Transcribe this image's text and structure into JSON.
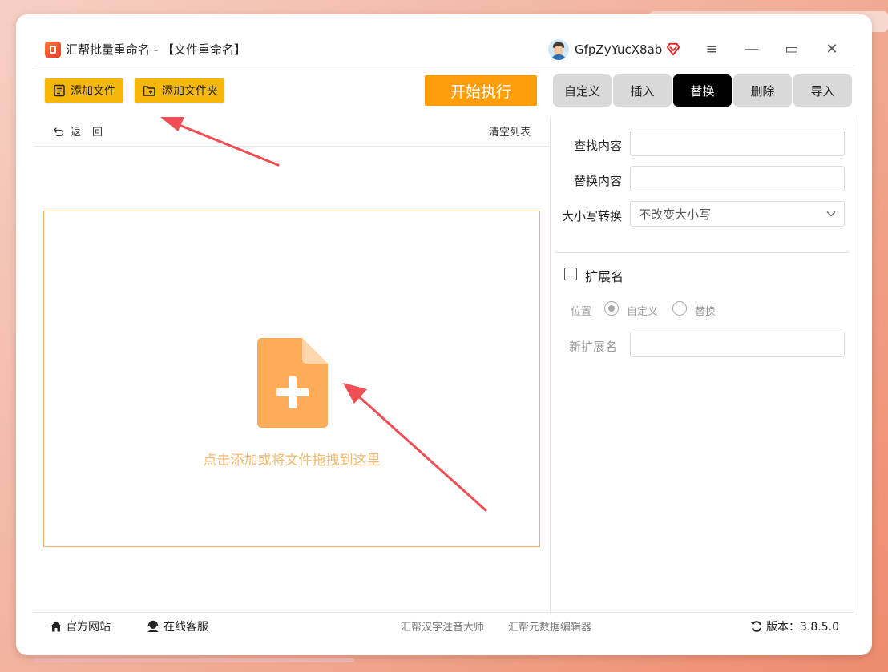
{
  "app": {
    "title": "汇帮批量重命名 - 【文件重命名】",
    "username": "GfpZyYucX8ab"
  },
  "window_controls": {
    "menu": "≡",
    "minimize": "—",
    "maximize": "▭",
    "close": "✕"
  },
  "toolbar": {
    "add_file": "添加文件",
    "add_folder": "添加文件夹",
    "start": "开始执行"
  },
  "tabs": [
    {
      "label": "自定义",
      "active": false
    },
    {
      "label": "插入",
      "active": false
    },
    {
      "label": "替换",
      "active": true
    },
    {
      "label": "删除",
      "active": false
    },
    {
      "label": "导入",
      "active": false
    }
  ],
  "file_list": {
    "back": "返回",
    "clear": "清空列表",
    "drop_text": "点击添加或将文件拖拽到这里"
  },
  "replace_panel": {
    "find_label": "查找内容",
    "find_value": "",
    "replace_label": "替换内容",
    "replace_value": "",
    "case_label": "大小写转换",
    "case_value": "不改变大小写",
    "extension_label": "扩展名",
    "extension_checked": false,
    "position_label": "位置",
    "position_options": [
      "自定义",
      "替换"
    ],
    "position_selected": "自定义",
    "new_ext_label": "新扩展名",
    "new_ext_value": ""
  },
  "footer": {
    "website": "官方网站",
    "support": "在线客服",
    "link1": "汇帮汉字注音大师",
    "link2": "汇帮元数据编辑器",
    "version": "版本：3.8.5.0"
  },
  "colors": {
    "accent_yellow": "#f5b70a",
    "start_orange": "#ff9e0a",
    "active_tab": "#000000",
    "drop_orange": "#ffac5a",
    "annotation_red": "#ef4e55"
  }
}
